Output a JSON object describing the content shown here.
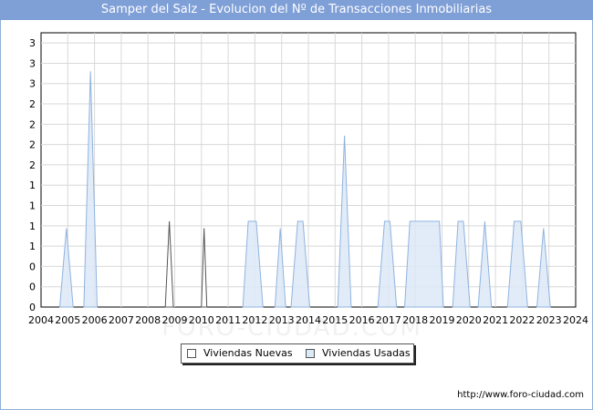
{
  "title": "Samper del Salz - Evolucion del Nº de Transacciones Inmobiliarias",
  "watermark": "FORO-CIUDAD.COM",
  "url": "http://www.foro-ciudad.com",
  "colors": {
    "title_bg": "#7f9fd7",
    "nuevas_fill": "#ffffff",
    "nuevas_stroke": "#555555",
    "usadas_fill": "#dce9f7",
    "usadas_stroke": "#8fb3e0",
    "grid": "#d8d8d8"
  },
  "chart_data": {
    "type": "area",
    "title": "Samper del Salz - Evolucion del Nº de Transacciones Inmobiliarias",
    "xlabel": "",
    "ylabel": "",
    "x_tick_labels": [
      "2004",
      "2005",
      "2006",
      "2007",
      "2008",
      "2009",
      "2010",
      "2011",
      "2012",
      "2013",
      "2014",
      "2015",
      "2016",
      "2017",
      "2018",
      "2019",
      "2020",
      "2021",
      "2022",
      "2023",
      "2024"
    ],
    "y_tick_labels": [
      "0",
      "0",
      "0",
      "1",
      "1",
      "1",
      "1",
      "2",
      "2",
      "2",
      "2",
      "3",
      "3",
      "3"
    ],
    "xlim": [
      2004,
      2024
    ],
    "ylim": [
      0,
      3.2
    ],
    "grid": true,
    "legend_position": "bottom",
    "series": [
      {
        "name": "Viviendas Nuevas",
        "points": [
          [
            2008.65,
            0
          ],
          [
            2008.8,
            1
          ],
          [
            2008.95,
            0
          ],
          [
            2010.0,
            0
          ],
          [
            2010.1,
            0.92
          ],
          [
            2010.2,
            0
          ]
        ]
      },
      {
        "name": "Viviendas Usadas",
        "points": [
          [
            2004.7,
            0
          ],
          [
            2004.95,
            0.92
          ],
          [
            2005.2,
            0
          ],
          [
            2005.6,
            0
          ],
          [
            2005.85,
            2.75
          ],
          [
            2006.1,
            0
          ],
          [
            2011.55,
            0
          ],
          [
            2011.75,
            1
          ],
          [
            2012.05,
            1
          ],
          [
            2012.3,
            0
          ],
          [
            2012.75,
            0
          ],
          [
            2012.95,
            0.92
          ],
          [
            2013.15,
            0
          ],
          [
            2013.35,
            0
          ],
          [
            2013.6,
            1
          ],
          [
            2013.8,
            1
          ],
          [
            2014.05,
            0
          ],
          [
            2015.1,
            0
          ],
          [
            2015.35,
            2.0
          ],
          [
            2015.6,
            0
          ],
          [
            2016.6,
            0
          ],
          [
            2016.85,
            1
          ],
          [
            2017.05,
            1
          ],
          [
            2017.3,
            0
          ],
          [
            2017.6,
            0
          ],
          [
            2017.8,
            1
          ],
          [
            2018.9,
            1
          ],
          [
            2019.05,
            0
          ],
          [
            2019.4,
            0
          ],
          [
            2019.6,
            1
          ],
          [
            2019.8,
            1
          ],
          [
            2020.05,
            0
          ],
          [
            2020.35,
            0
          ],
          [
            2020.6,
            1
          ],
          [
            2020.85,
            0
          ],
          [
            2021.45,
            0
          ],
          [
            2021.7,
            1
          ],
          [
            2021.95,
            1
          ],
          [
            2022.2,
            0
          ],
          [
            2022.55,
            0
          ],
          [
            2022.8,
            0.92
          ],
          [
            2023.05,
            0
          ]
        ]
      }
    ]
  }
}
